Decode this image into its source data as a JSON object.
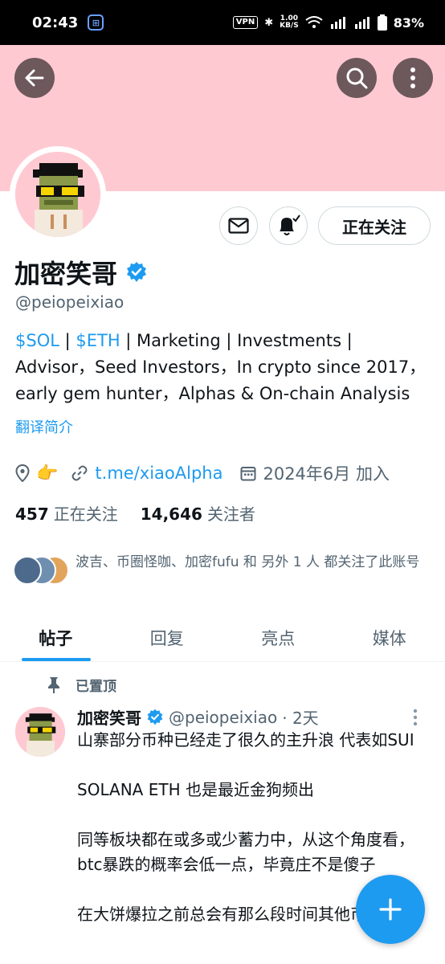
{
  "status_bar": {
    "time": "02:43",
    "vpn": "VPN",
    "net_speed_value": "1.00",
    "net_speed_unit": "KB/S",
    "battery": "83%"
  },
  "profile": {
    "display_name": "加密笑哥",
    "handle": "@peiopeixiao",
    "follow_button": "正在关注",
    "bio": {
      "tag1": "$SOL",
      "sep1": " | ",
      "tag2": "$ETH",
      "rest": " | Marketing | Investments | Advisor，Seed Investors，In crypto since 2017，early gem hunter，Alphas & On-chain Analysis"
    },
    "translate_label": "翻译简介",
    "meta": {
      "location_emoji": "👉",
      "link": "t.me/xiaoAlpha",
      "joined": "2024年6月 加入"
    },
    "stats": {
      "following_count": "457",
      "following_label": "正在关注",
      "followers_count": "14,646",
      "followers_label": "关注者"
    },
    "followed_by": "波吉、币圈怪咖、加密fufu 和 另外 1 人 都关注了此账号"
  },
  "tabs": [
    {
      "label": "帖子",
      "active": true
    },
    {
      "label": "回复",
      "active": false
    },
    {
      "label": "亮点",
      "active": false
    },
    {
      "label": "媒体",
      "active": false
    }
  ],
  "pinned_post": {
    "pinned_label": "已置顶",
    "author_name": "加密笑哥",
    "author_handle": "@peiopeixiao",
    "time_ago": "· 2天",
    "paragraphs": [
      "山寨部分币种已经走了很久的主升浪 代表如SUI",
      "SOLANA ETH 也是最近金狗频出",
      "同等板块都在或多或少蓄力中，从这个角度看，btc暴跌的概率会低一点，毕竟庄不是傻子",
      "在大饼爆拉之前总会有那么段时间其他币种"
    ]
  },
  "icons": {
    "back": "arrow-left-icon",
    "search": "search-icon",
    "more": "more-vertical-icon",
    "mail": "mail-icon",
    "bell": "bell-check-icon",
    "verified": "verified-badge-icon",
    "location": "location-icon",
    "link": "link-icon",
    "calendar": "calendar-icon",
    "pin": "pin-icon",
    "compose": "plus-icon"
  },
  "colors": {
    "accent": "#1d9bf0",
    "banner": "#ffc9d2",
    "muted_text": "#536471"
  }
}
